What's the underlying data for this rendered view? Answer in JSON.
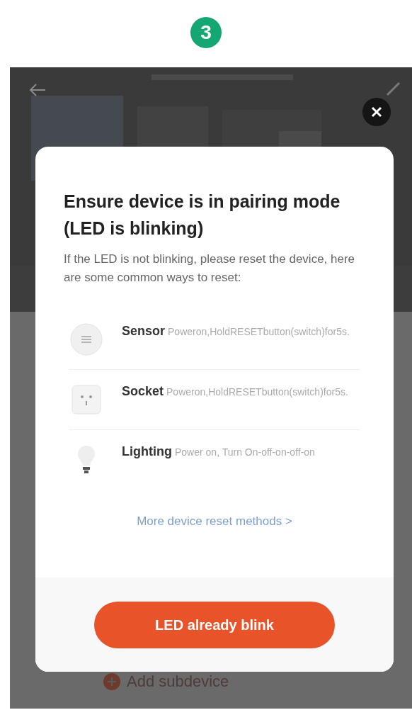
{
  "step_number": "3",
  "dialog": {
    "title": "Ensure device is in pairing mode (LED is blinking)",
    "description": "If the LED is not blinking, please reset the device, here are some common ways to reset:",
    "methods": [
      {
        "kind": "sensor",
        "name": "Sensor",
        "instruction": "Poweron,HoldRESETbutton(switch)for5s."
      },
      {
        "kind": "socket",
        "name": "Socket",
        "instruction": "Poweron,HoldRESETbutton(switch)for5s."
      },
      {
        "kind": "lighting",
        "name": "Lighting",
        "instruction": "Power on, Turn On-off-on-off-on"
      }
    ],
    "more_link": "More device reset methods >",
    "confirm_button": "LED already blink"
  },
  "background": {
    "add_button": "Add subdevice"
  }
}
